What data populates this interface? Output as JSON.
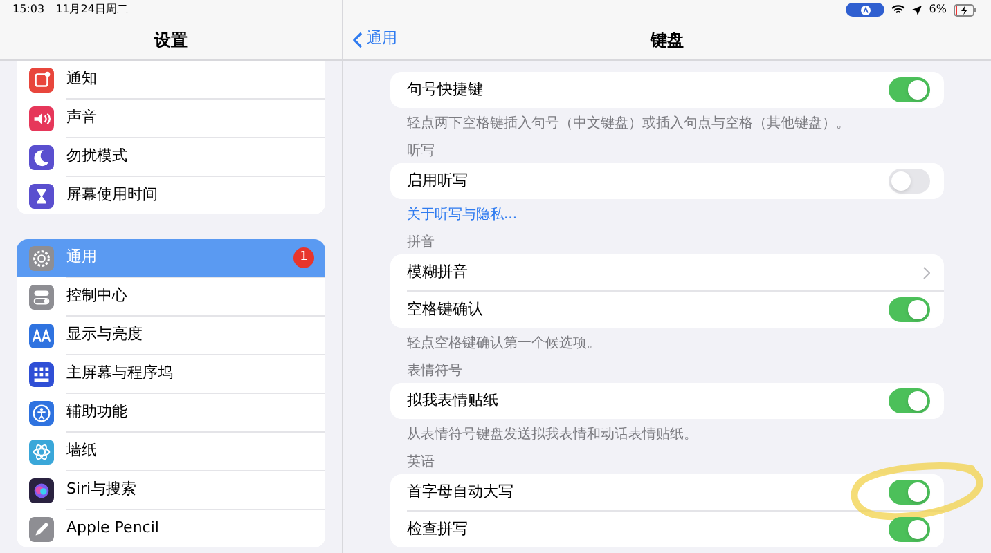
{
  "status_bar": {
    "time": "15:03",
    "date": "11月24日周二",
    "battery": "6%"
  },
  "sidebar": {
    "title": "设置",
    "groups": [
      {
        "items": [
          {
            "label": "通知",
            "color": "#e8463c",
            "selected": false
          },
          {
            "label": "声音",
            "color": "#e6375a",
            "selected": false
          },
          {
            "label": "勿扰模式",
            "color": "#5a4fcf",
            "selected": false
          },
          {
            "label": "屏幕使用时间",
            "color": "#5a4fcf",
            "selected": false
          }
        ]
      },
      {
        "items": [
          {
            "label": "通用",
            "color": "#8e8e93",
            "selected": true,
            "badge": "1"
          },
          {
            "label": "控制中心",
            "color": "#8e8e93",
            "selected": false
          },
          {
            "label": "显示与亮度",
            "color": "#2f73e0",
            "selected": false
          },
          {
            "label": "主屏幕与程序坞",
            "color": "#2f4fd6",
            "selected": false
          },
          {
            "label": "辅助功能",
            "color": "#2f73e0",
            "selected": false
          },
          {
            "label": "墙纸",
            "color": "#3aa7d9",
            "selected": false
          },
          {
            "label": "Siri与搜索",
            "color": "#2a2240",
            "selected": false
          },
          {
            "label": "Apple Pencil",
            "color": "#8e8e93",
            "selected": false
          }
        ]
      }
    ]
  },
  "detail": {
    "back": "通用",
    "title": "键盘",
    "sections": [
      {
        "rows": [
          {
            "label": "句号快捷键",
            "kind": "toggle",
            "on": true
          }
        ],
        "footer": {
          "kind": "note",
          "text": "轻点两下空格键插入句号（中文键盘）或插入句点与空格（其他键盘）。"
        }
      },
      {
        "header": "听写",
        "rows": [
          {
            "label": "启用听写",
            "kind": "toggle",
            "on": false
          }
        ],
        "footer": {
          "kind": "link",
          "text": "关于听写与隐私..."
        }
      },
      {
        "header": "拼音",
        "rows": [
          {
            "label": "模糊拼音",
            "kind": "link"
          },
          {
            "label": "空格键确认",
            "kind": "toggle",
            "on": true
          }
        ],
        "footer": {
          "kind": "note",
          "text": "轻点空格键确认第一个候选项。"
        }
      },
      {
        "header": "表情符号",
        "rows": [
          {
            "label": "拟我表情贴纸",
            "kind": "toggle",
            "on": true
          }
        ],
        "footer": {
          "kind": "note",
          "text": "从表情符号键盘发送拟我表情和动话表情贴纸。"
        }
      },
      {
        "header": "英语",
        "rows": [
          {
            "label": "首字母自动大写",
            "kind": "toggle",
            "on": true,
            "highlighted": true
          },
          {
            "label": "检查拼写",
            "kind": "toggle",
            "on": true
          }
        ]
      }
    ]
  }
}
